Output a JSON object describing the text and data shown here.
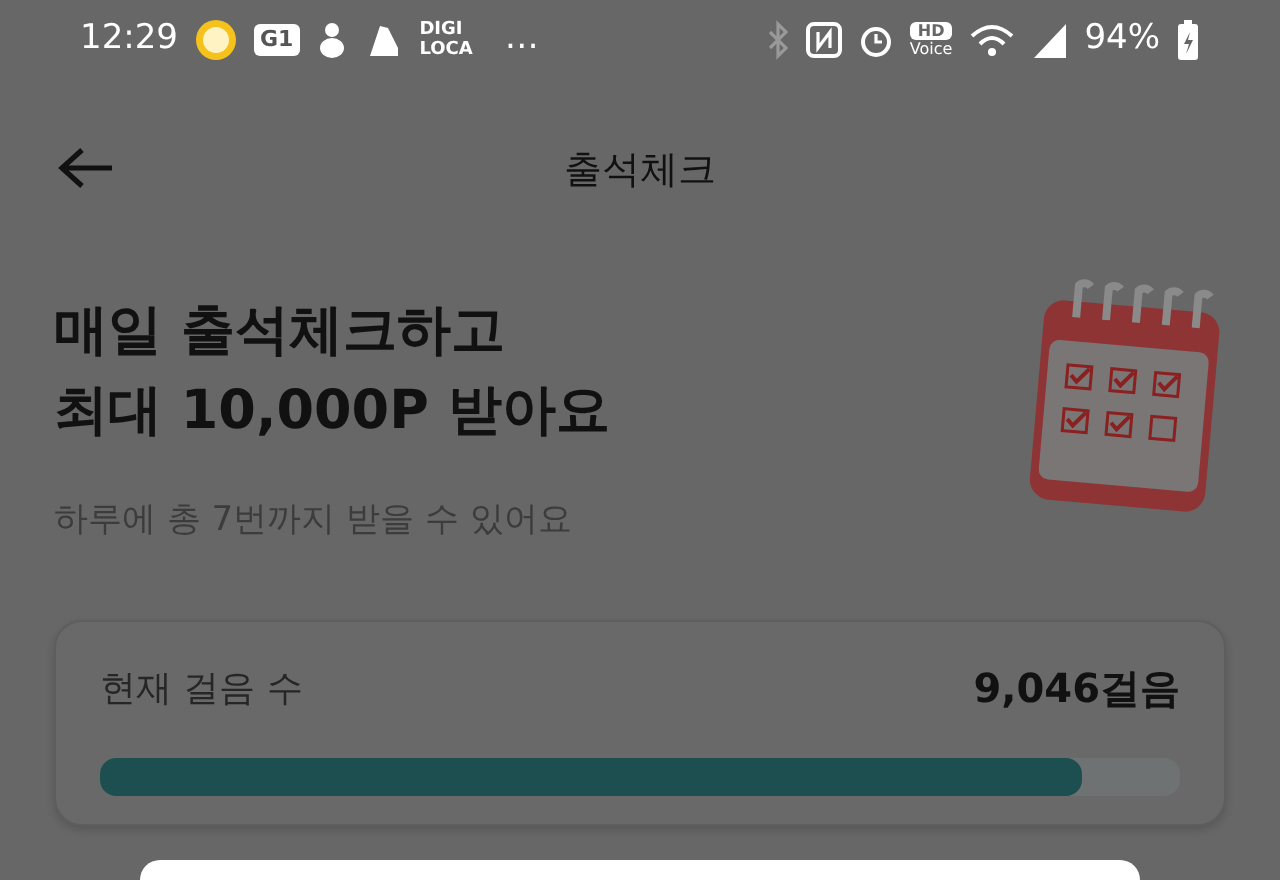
{
  "status_bar": {
    "time": "12:29",
    "app_badge": "G1",
    "app_label": [
      "DIGI",
      "LOCA"
    ],
    "more": "…",
    "hd_label": [
      "HD",
      "Voice"
    ],
    "battery": "94%"
  },
  "header": {
    "title": "출석체크"
  },
  "hero": {
    "title_lines": [
      "매일 출석체크하고",
      "최대 10,000P 받아요"
    ],
    "subtitle": "하루에 총 7번까지 받을 수 있어요"
  },
  "steps_card": {
    "label": "현재 걸음 수",
    "value": "9,046걸음",
    "level": 0.91
  }
}
